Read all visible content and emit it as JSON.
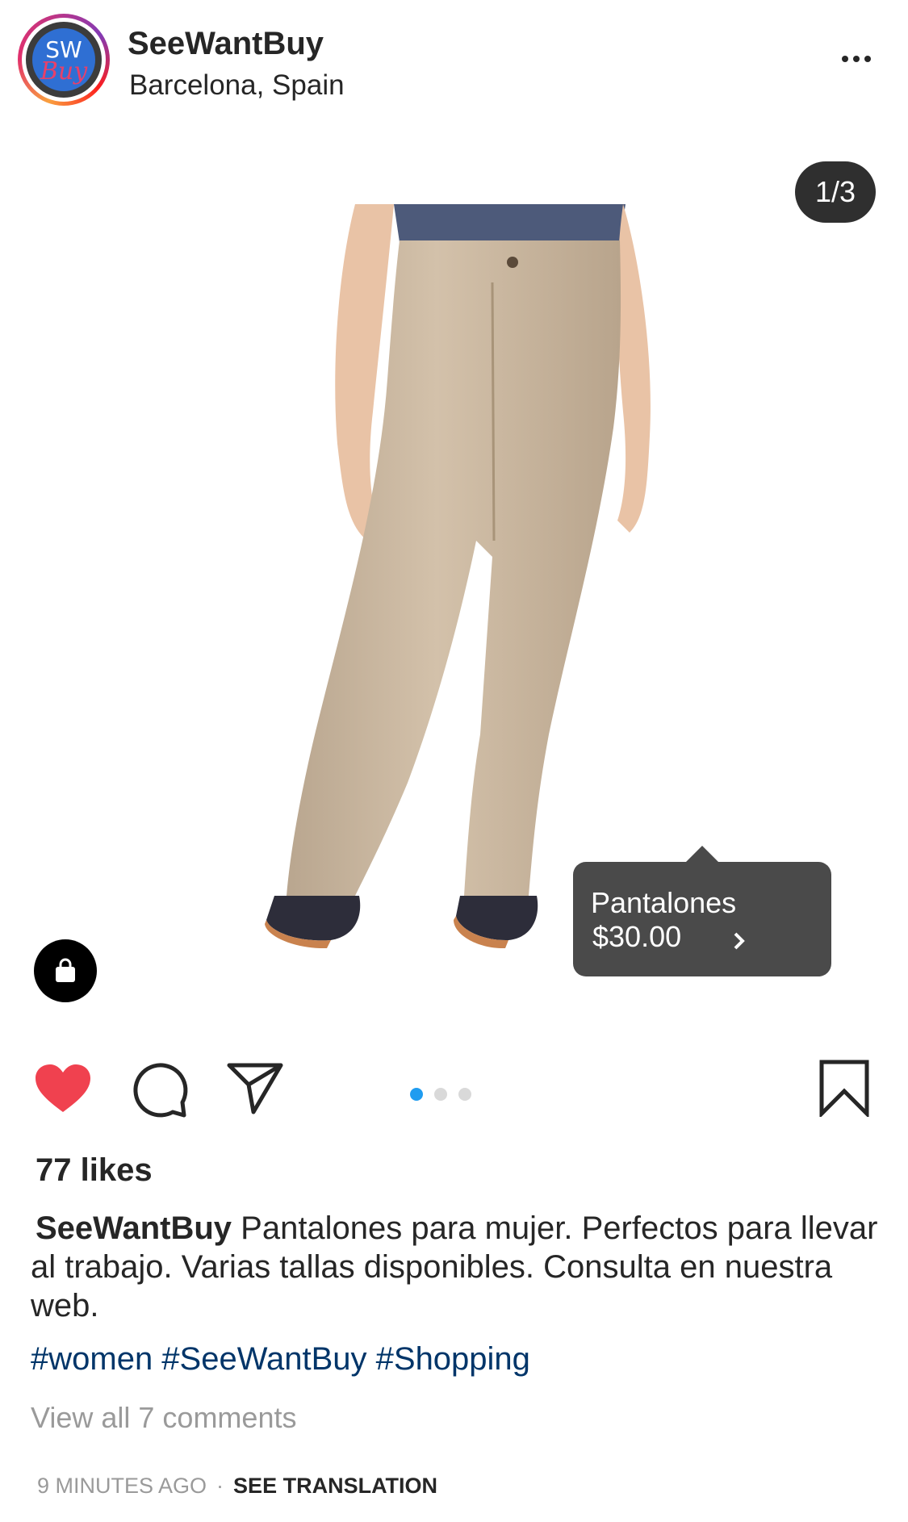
{
  "header": {
    "avatar_text_top": "SW",
    "avatar_text_bottom": "Buy",
    "username": "SeeWantBuy",
    "location": "Barcelona, Spain",
    "more_icon": "more-horizontal-icon"
  },
  "post": {
    "image_counter": "1/3",
    "image_subject": "pants-photo",
    "shopping_icon": "shopping-bag-icon",
    "product_tag": {
      "name": "Pantalones",
      "price": "$30.00"
    },
    "carousel": {
      "current": 1,
      "total": 3
    }
  },
  "actions": {
    "like_icon": "heart-filled-icon",
    "comment_icon": "comment-icon",
    "share_icon": "send-icon",
    "save_icon": "bookmark-icon"
  },
  "likes_text": "77 likes",
  "caption": {
    "username": "SeeWantBuy",
    "text": "Pantalones para mujer. Perfectos para llevar al trabajo. Varias tallas disponibles. Consulta en nuestra web."
  },
  "hashtags": "#women #SeeWantBuy #Shopping",
  "comments_link": "View all 7 comments",
  "footer": {
    "time": "9 MINUTES AGO",
    "separator": "·",
    "translation": "SEE TRANSLATION"
  },
  "colors": {
    "like": "#f0414f",
    "hashtag": "#003569",
    "active_dot": "#1f9cf0",
    "tag_bg": "#4a4a4a"
  }
}
